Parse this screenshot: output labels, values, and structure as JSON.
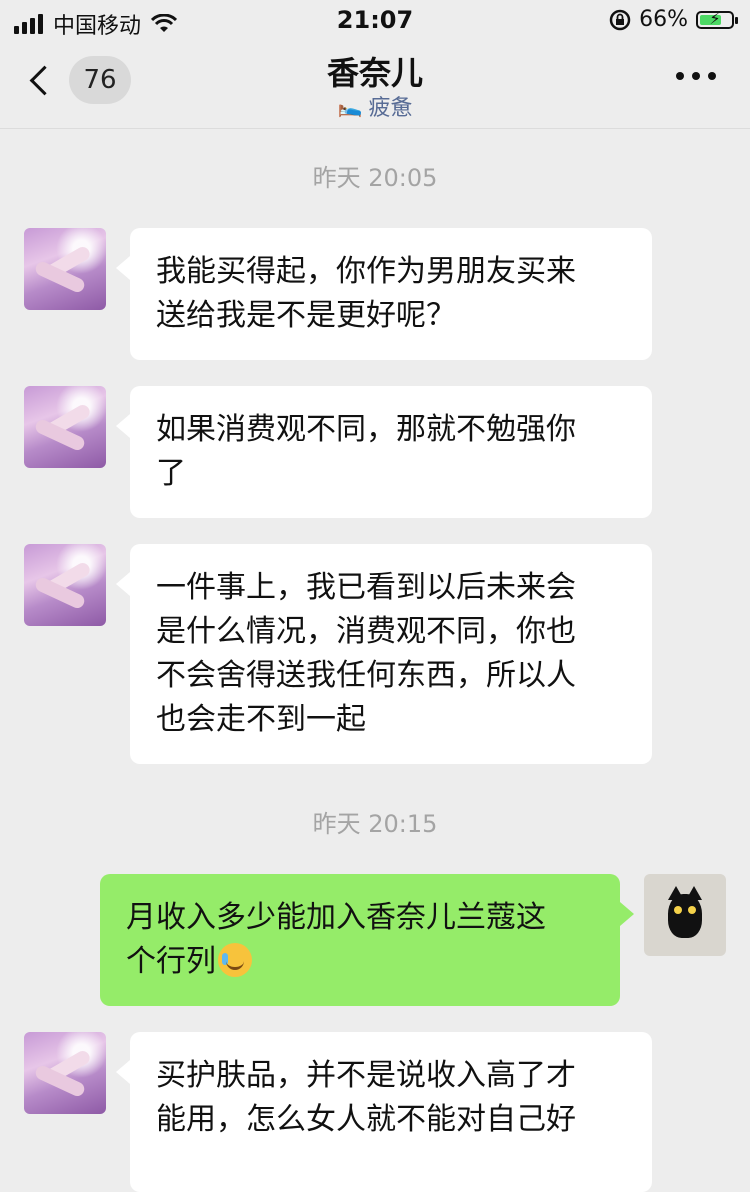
{
  "status_bar": {
    "carrier": "中国移动",
    "time": "21:07",
    "battery_percent": "66%"
  },
  "header": {
    "back_badge": "76",
    "title": "香奈儿",
    "status_text": "疲惫",
    "status_icon": "tired-status-icon"
  },
  "colors": {
    "background": "#ededed",
    "my_bubble": "#95ec69",
    "their_bubble": "#ffffff",
    "status_link": "#576b95"
  },
  "messages": [
    {
      "type": "timestamp",
      "text": "昨天 20:05"
    },
    {
      "type": "received",
      "lines": [
        "我能买得起，你作为男朋友买来",
        "送给我是不是更好呢？"
      ]
    },
    {
      "type": "received",
      "lines": [
        "如果消费观不同，那就不勉强你",
        "了"
      ]
    },
    {
      "type": "received",
      "lines": [
        "一件事上，我已看到以后未来会",
        "是什么情况，消费观不同，你也",
        "不会舍得送我任何东西，所以人",
        "也会走不到一起"
      ]
    },
    {
      "type": "timestamp",
      "text": "昨天 20:15"
    },
    {
      "type": "sent",
      "lines": [
        "月收入多少能加入香奈儿兰蔻这",
        "个行列"
      ],
      "emoji": "laughing-crying-emoji"
    },
    {
      "type": "received",
      "lines": [
        "买护肤品，并不是说收入高了才",
        "能用，怎么女人就不能对自己好"
      ]
    }
  ]
}
